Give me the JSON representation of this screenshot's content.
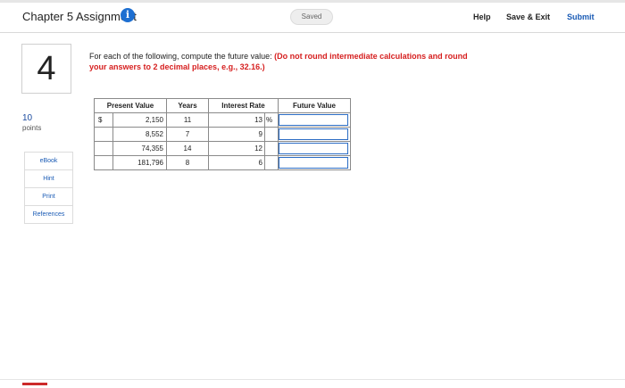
{
  "header": {
    "title": "Chapter 5 Assignment",
    "info_icon": "i",
    "saved": "Saved",
    "help": "Help",
    "save_exit": "Save & Exit",
    "submit": "Submit"
  },
  "question": {
    "number": "4",
    "points_value": "10",
    "points_label": "points",
    "instruction_text": "For each of the following, compute the future value: ",
    "instruction_red": "(Do not round intermediate calculations and round your answers to 2 decimal places, e.g., 32.16.)"
  },
  "side_buttons": [
    "eBook",
    "Hint",
    "Print",
    "References"
  ],
  "table": {
    "headers": [
      "Present Value",
      "Years",
      "Interest Rate",
      "Future Value"
    ],
    "currency_symbol": "$",
    "percent_symbol": "%",
    "rows": [
      {
        "present_value": "2,150",
        "years": "11",
        "rate": "13",
        "future_value": ""
      },
      {
        "present_value": "8,552",
        "years": "7",
        "rate": "9",
        "future_value": ""
      },
      {
        "present_value": "74,355",
        "years": "14",
        "rate": "12",
        "future_value": ""
      },
      {
        "present_value": "181,796",
        "years": "8",
        "rate": "6",
        "future_value": ""
      }
    ]
  },
  "colors": {
    "accent": "#1a5bb5",
    "warning": "#d62020",
    "input_border": "#2b6cc4"
  }
}
